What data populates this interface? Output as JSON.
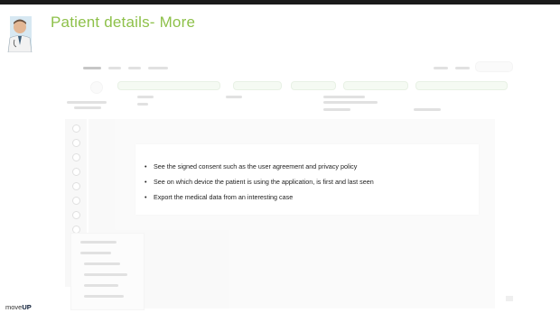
{
  "slide": {
    "title": "Patient details- More",
    "bullets": [
      "See the signed consent such as the user agreement and privacy policy",
      "See on which device the patient is using the application, is first and last seen",
      "Export the medical data from an interesting case"
    ],
    "logo_prefix": "move",
    "logo_suffix": "UP",
    "accent_color": "#8ec14a"
  }
}
